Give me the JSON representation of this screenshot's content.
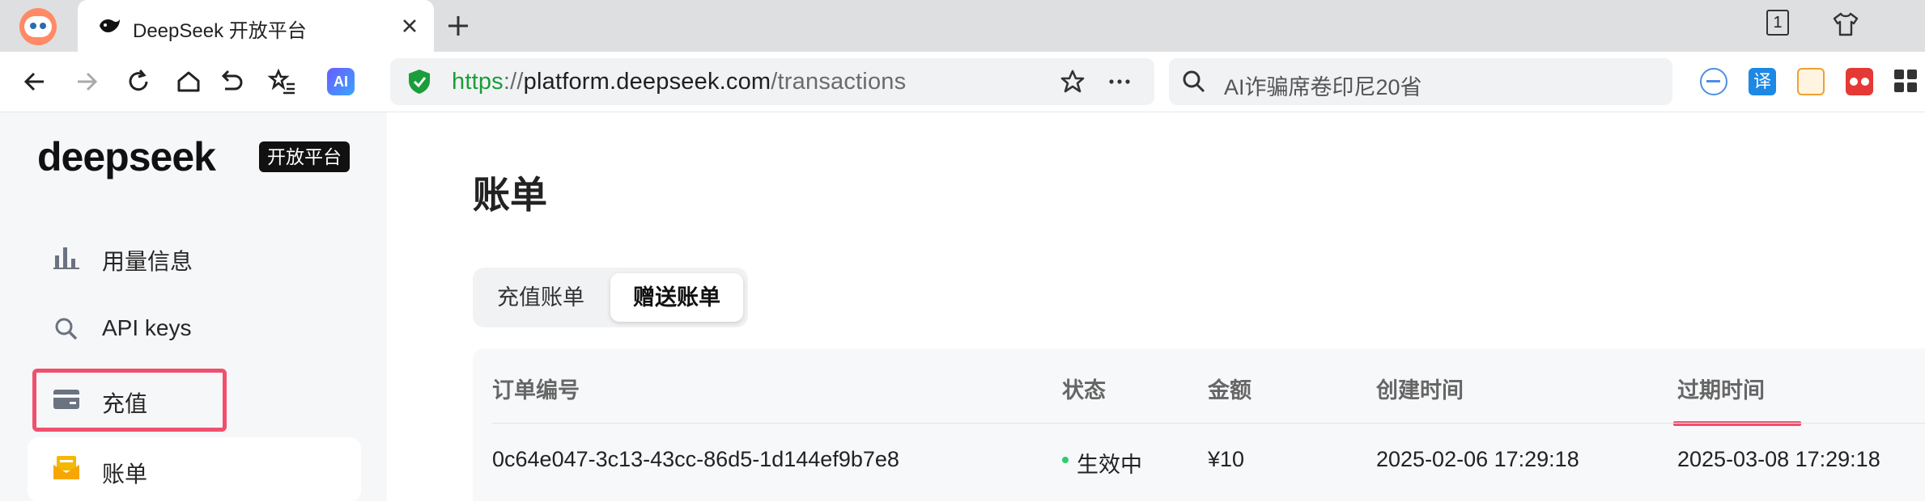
{
  "browser": {
    "tab": {
      "title": "DeepSeek 开放平台"
    },
    "tab_count": "1",
    "address": {
      "scheme": "https",
      "separator": "://",
      "host": "platform.deepseek.com",
      "path": "/transactions"
    },
    "search": {
      "text": "AI诈骗席卷印尼20省"
    },
    "ai_badge": "AI",
    "ext_translate": "译",
    "accent_green": "#1a9e3a"
  },
  "sidebar": {
    "logo_text": "deepseek",
    "platform_tag": "开放平台",
    "items": [
      {
        "label": "用量信息",
        "icon": "bar-chart-icon"
      },
      {
        "label": "API keys",
        "icon": "search-icon"
      },
      {
        "label": "充值",
        "icon": "wallet-icon"
      },
      {
        "label": "账单",
        "icon": "envelope-icon"
      }
    ],
    "highlight_color": "#f0506e"
  },
  "main": {
    "title": "账单",
    "tabs": [
      {
        "label": "充值账单",
        "active": false
      },
      {
        "label": "赠送账单",
        "active": true
      }
    ],
    "table": {
      "columns": [
        "订单编号",
        "状态",
        "金额",
        "创建时间",
        "过期时间"
      ],
      "rows": [
        {
          "order_id": "0c64e047-3c13-43cc-86d5-1d144ef9b7e8",
          "status": "生效中",
          "amount": "¥10",
          "created": "2025-02-06 17:29:18",
          "expires": "2025-03-08 17:29:18"
        }
      ]
    }
  }
}
